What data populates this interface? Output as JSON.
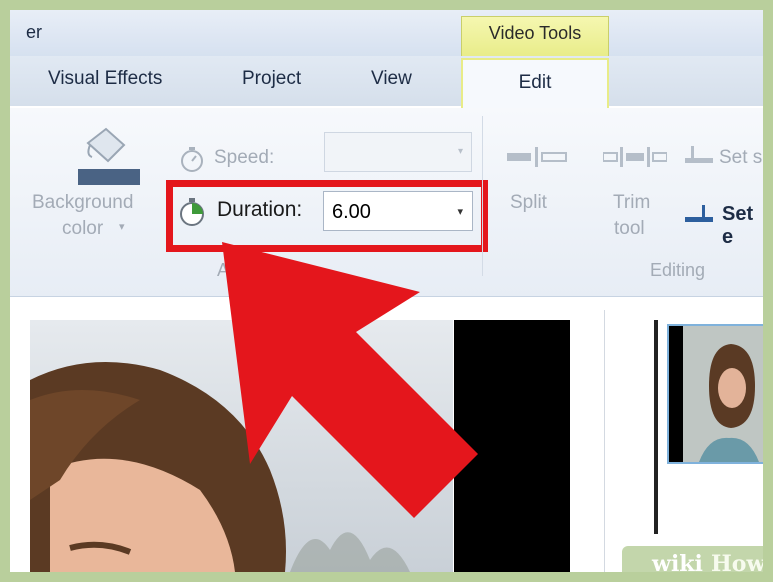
{
  "window": {
    "title_fragment": "er",
    "context_tab": "Video Tools"
  },
  "tabs": {
    "visual_effects": "Visual Effects",
    "project": "Project",
    "view": "View",
    "edit": "Edit"
  },
  "ribbon": {
    "background_color_line1": "Background",
    "background_color_line2": "color",
    "background_color_arrow": "▾",
    "speed_label": "Speed:",
    "speed_value": "",
    "duration_label": "Duration:",
    "duration_value": "6.00",
    "adjust_group_fragment": "A",
    "split_label": "Split",
    "trim_tool_line1": "Trim",
    "trim_tool_line2": "tool",
    "set_start_fragment": "Set s",
    "set_end_fragment": "Set e",
    "editing_group": "Editing",
    "dropdown_glyph": "▾"
  },
  "watermark": {
    "part1": "wiki",
    "part2": "How"
  },
  "colors": {
    "highlight": "#e4161c",
    "arrow": "#e4161c",
    "context_tab": "#e8ec88",
    "border": "#b9cf9c"
  }
}
